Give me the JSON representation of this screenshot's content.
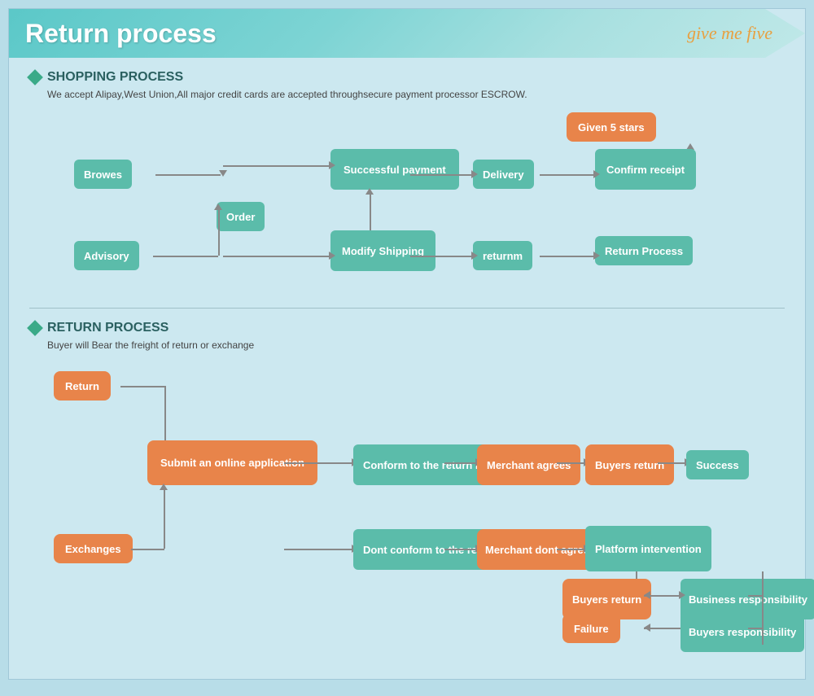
{
  "header": {
    "title": "Return process",
    "logo": "give me five"
  },
  "shopping_section": {
    "title": "SHOPPING PROCESS",
    "subtitle": "We accept Alipay,West Union,All major credit cards are accepted throughsecure payment processor ESCROW.",
    "boxes": {
      "browes": "Browes",
      "order": "Order",
      "advisory": "Advisory",
      "successful_payment": "Successful payment",
      "modify_shipping": "Modify Shipping",
      "delivery": "Delivery",
      "confirm_receipt": "Confirm receipt",
      "given_5_stars": "Given 5 stars",
      "returnm": "returnm",
      "return_process": "Return Process"
    }
  },
  "return_section": {
    "title": "RETURN PROCESS",
    "subtitle": "Buyer will Bear the freight of return or exchange",
    "boxes": {
      "return_btn": "Return",
      "submit_online": "Submit an online application",
      "conform_rules": "Conform to the return rules",
      "merchant_agrees": "Merchant agrees",
      "buyers_return": "Buyers return",
      "success": "Success",
      "exchanges": "Exchanges",
      "dont_conform": "Dont conform to the return rules",
      "merchant_dont_agrees": "Merchant dont agrees",
      "platform_intervention": "Platform intervention",
      "buyers_return2": "Buyers return",
      "business_responsibility": "Business responsibility",
      "failure": "Failure",
      "buyers_responsibility": "Buyers responsibility"
    }
  }
}
